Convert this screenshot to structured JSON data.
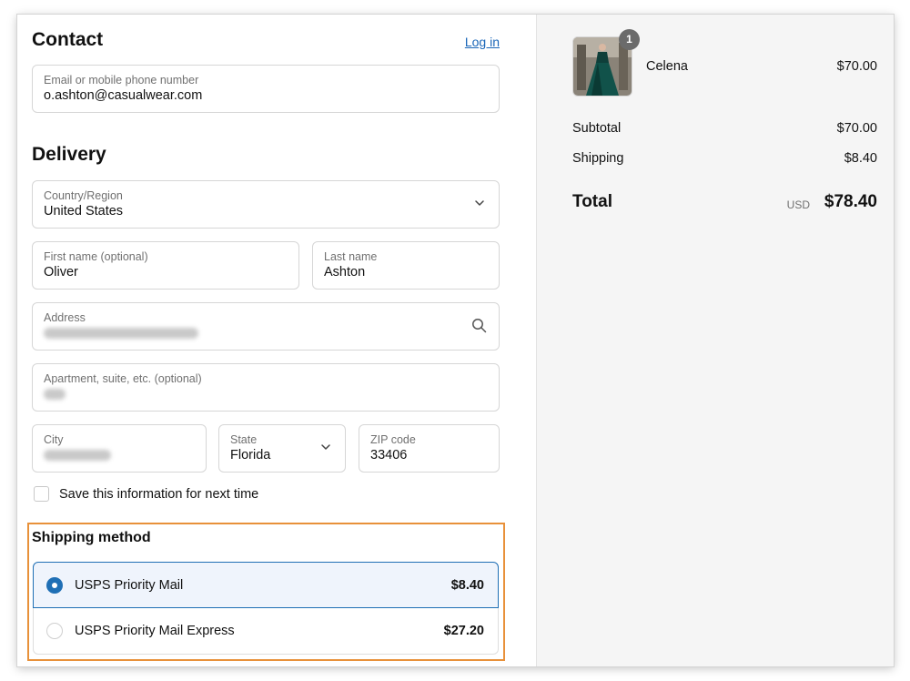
{
  "contact": {
    "title": "Contact",
    "login_label": "Log in",
    "email_label": "Email or mobile phone number",
    "email_value": "o.ashton@casualwear.com"
  },
  "delivery": {
    "title": "Delivery",
    "country_label": "Country/Region",
    "country_value": "United States",
    "first_name_label": "First name (optional)",
    "first_name_value": "Oliver",
    "last_name_label": "Last name",
    "last_name_value": "Ashton",
    "address_label": "Address",
    "apartment_label": "Apartment, suite, etc. (optional)",
    "city_label": "City",
    "state_label": "State",
    "state_value": "Florida",
    "zip_label": "ZIP code",
    "zip_value": "33406",
    "save_info_label": "Save this information for next time"
  },
  "shipping": {
    "title": "Shipping method",
    "options": [
      {
        "label": "USPS Priority Mail",
        "price": "$8.40",
        "selected": true
      },
      {
        "label": "USPS Priority Mail Express",
        "price": "$27.20",
        "selected": false
      }
    ]
  },
  "summary": {
    "item": {
      "name": "Celena",
      "price": "$70.00",
      "quantity": "1"
    },
    "subtotal_label": "Subtotal",
    "subtotal_value": "$70.00",
    "shipping_label": "Shipping",
    "shipping_value": "$8.40",
    "total_label": "Total",
    "currency": "USD",
    "total_value": "$78.40"
  },
  "colors": {
    "accent": "#1f6fb5",
    "highlight_border": "#e8913a",
    "summary_bg": "#f5f5f5"
  }
}
